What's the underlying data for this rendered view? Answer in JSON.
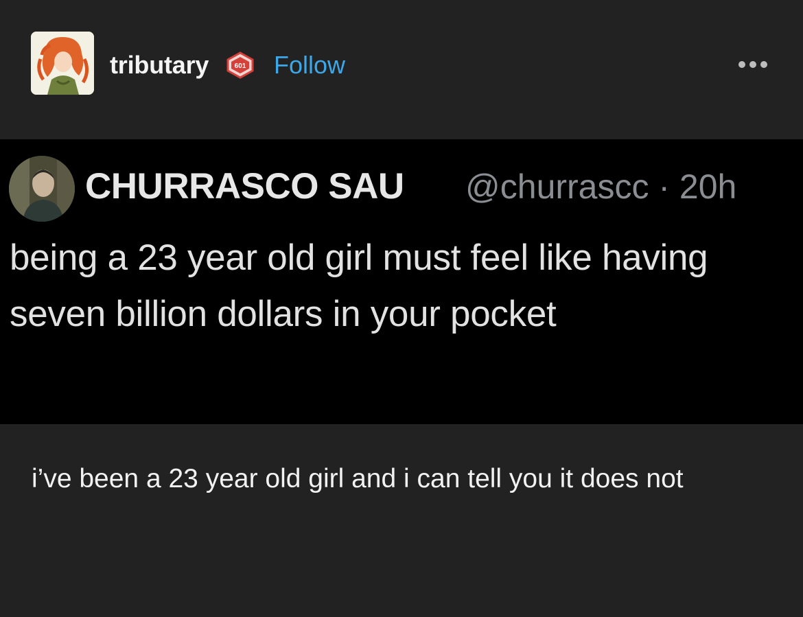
{
  "post": {
    "username": "tributary",
    "badge_text": "601",
    "follow_label": "Follow",
    "more_icon": "ellipsis-icon"
  },
  "tweet": {
    "display_name": "CHURRASCO SAU",
    "handle_time": "@churrascc · 20h",
    "text": "being a 23 year old girl must feel like having seven billion dollars in your pocket"
  },
  "reply": {
    "text": "i’ve been a 23 year old girl and i can tell you it does not"
  },
  "colors": {
    "background": "#222222",
    "tweet_background": "#000000",
    "follow": "#3da7e8",
    "badge": "#d6403a"
  }
}
